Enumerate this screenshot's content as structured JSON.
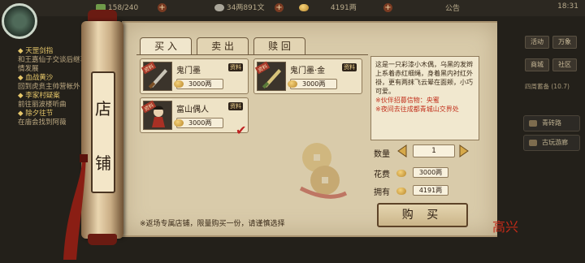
{
  "top_bar": {
    "stamina": "158/240",
    "silver": "34两891文",
    "gold": "4191两",
    "notice": "公告",
    "time": "18:31"
  },
  "quests": [
    {
      "title": "天罡剑指",
      "desc": "和王嘉仙子交谈后继事情发展"
    },
    {
      "title": "血战黄沙",
      "desc": "回到虎贲主帅营帐外"
    },
    {
      "title": "李家村疑案",
      "desc": "前往丽波楼听曲"
    },
    {
      "title": "除夕往节",
      "desc": "在庙会找到阿薇"
    }
  ],
  "sign": {
    "char1": "店",
    "char2": "铺"
  },
  "tabs": [
    {
      "label": "买 入"
    },
    {
      "label": "卖 出"
    },
    {
      "label": "赎 回"
    }
  ],
  "items": [
    {
      "name": "鬼门墨",
      "badge": "资料",
      "price": "3000两",
      "tag": "资料"
    },
    {
      "name": "鬼门墨·金",
      "badge": "资料",
      "price": "3000两",
      "tag": "资料"
    },
    {
      "name": "富山偶人",
      "badge": "资料",
      "price": "3000两",
      "tag": "资料",
      "selected": true
    }
  ],
  "description": {
    "text": "这是一只彩漆小木偶，乌黑的发辫上系着赤红细绳，身着黑内衬红外褂，更有两抹飞云晕在面颊，小巧可爱。",
    "hint1": "※伙伴招募信物：央蜜",
    "hint2": "※夜间去往成都青城山交界处"
  },
  "purchase": {
    "qty_label": "数量",
    "qty": "1",
    "cost_label": "花费",
    "cost": "3000两",
    "owned_label": "拥有",
    "owned": "4191两",
    "buy_label": "购 买"
  },
  "footer_note": "※返场专属店铺，限量购买一份，请谨慎选择",
  "seal": "高兴",
  "sidebar": {
    "buttons": [
      "活动",
      "万象",
      "商城",
      "社区"
    ],
    "status": "四周蓄备 (10.7)",
    "menus": [
      "青砖路",
      "古玩游廊"
    ]
  },
  "colors": {
    "hint": "#c2301c",
    "accent": "#c02020"
  }
}
